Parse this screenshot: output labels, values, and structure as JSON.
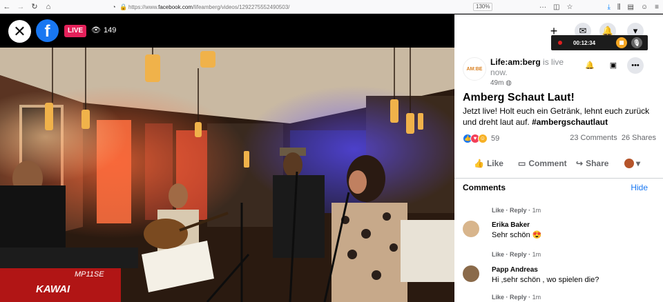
{
  "browser": {
    "url_prefix": "https://www.",
    "url_host": "facebook.com",
    "url_path": "/lifeamberg/videos/1292275552490503/",
    "zoom": "130%",
    "more": "···"
  },
  "video": {
    "live_label": "LIVE",
    "viewer_count": "149",
    "fb_letter": "f"
  },
  "recorder": {
    "time": "00:12:34"
  },
  "post": {
    "avatar_text": "AM:BE",
    "page_name": "Life:am:berg",
    "status": " is live now.",
    "age": "49m",
    "title": "Amberg Schaut Laut!",
    "text": "Jetzt live! Holt euch ein Getränk, lehnt euch zurück und dreht laut auf. ",
    "hashtag": "#ambergschautlaut",
    "reaction_count": "59",
    "comments_count": "23 Comments",
    "shares_count": "26 Shares"
  },
  "actions": {
    "like": "Like",
    "comment": "Comment",
    "share": "Share"
  },
  "comments": {
    "heading": "Comments",
    "hide": "Hide",
    "like": "Like",
    "reply": "Reply",
    "sep": "·",
    "items": [
      {
        "time": "1m"
      },
      {
        "name": "Erika Baker",
        "text": "Sehr schön 😍",
        "time": "1m"
      },
      {
        "name": "Papp Andreas",
        "text": "Hi ,sehr schön , wo spielen die?",
        "time": "1m"
      }
    ]
  }
}
